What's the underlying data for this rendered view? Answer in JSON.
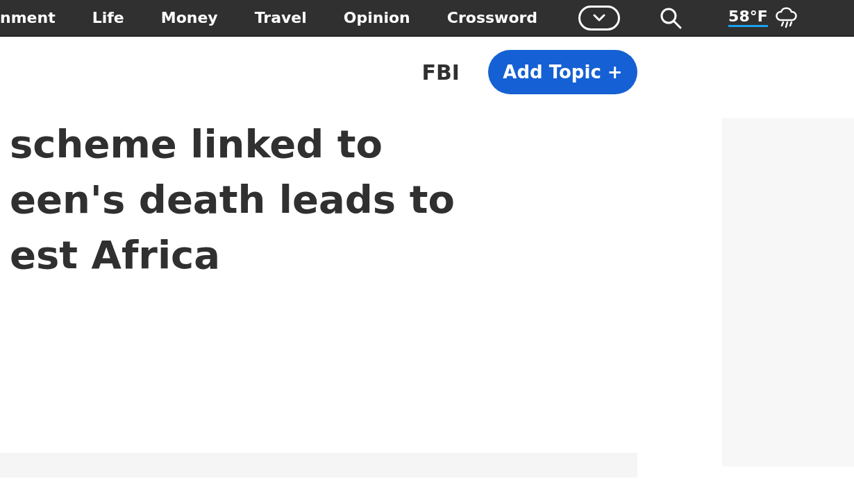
{
  "nav": {
    "items": [
      {
        "label": "nment"
      },
      {
        "label": "Life"
      },
      {
        "label": "Money"
      },
      {
        "label": "Travel"
      },
      {
        "label": "Opinion"
      },
      {
        "label": "Crossword"
      }
    ],
    "temperature": "58°F"
  },
  "topics": {
    "tag": "FBI",
    "button": "Add Topic +"
  },
  "headline": [
    "scheme linked to",
    "een's death leads to",
    "est Africa"
  ]
}
